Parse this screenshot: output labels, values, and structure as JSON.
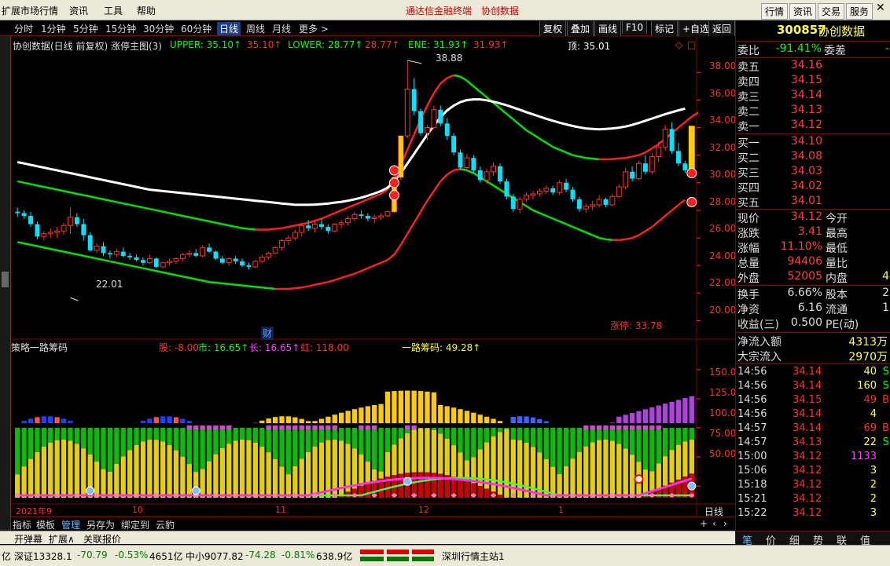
{
  "window": {
    "title": "通达信金融终端",
    "product": "协创数据"
  },
  "menu": {
    "items": [
      "扩展市场行情",
      "资讯",
      "工具",
      "帮助"
    ],
    "right_buttons": [
      "行情",
      "资讯",
      "交易",
      "服务"
    ]
  },
  "toolbar": {
    "periods": [
      "分时",
      "1分钟",
      "5分钟",
      "15分钟",
      "30分钟",
      "60分钟",
      "日线",
      "周线",
      "月线",
      "更多 >"
    ],
    "active_period": "日线",
    "right_buttons": [
      "复权",
      "叠加",
      "画线",
      "F10",
      "标记",
      "+自选",
      "返回"
    ]
  },
  "main_chart": {
    "header": "协创数据(日线 前复权) 涨停主图(3)",
    "indicators": [
      {
        "text": "UPPER: 35.10↑",
        "color": "#00ff00"
      },
      {
        "text": "35.10↑",
        "color": "#ff3030"
      },
      {
        "text": "LOWER: 28.77↑",
        "color": "#00ff00"
      },
      {
        "text": "28.77↑",
        "color": "#ff3030"
      },
      {
        "text": "ENE: 31.93↑",
        "color": "#00ff00"
      },
      {
        "text": "31.93↑",
        "color": "#ff3030"
      },
      {
        "text": "顶: 35.01",
        "color": "#ffffff"
      }
    ],
    "max_label": "38.88",
    "min_label": "22.01",
    "limit_label": "涨停: 33.78",
    "cai_label": "财",
    "yticks": [
      "38.00",
      "36.00",
      "34.00",
      "32.00",
      "30.00",
      "28.00",
      "26.00",
      "24.00",
      "22.00",
      "20.00"
    ]
  },
  "sub_chart": {
    "header": "策略一路筹码",
    "indicators": [
      {
        "text": "股: -8.00",
        "color": "#ff3030"
      },
      {
        "text": "市: 16.65↑",
        "color": "#00ff00"
      },
      {
        "text": "长: 16.65↑",
        "color": "#ff40ff"
      },
      {
        "text": "虹: 118.00",
        "color": "#ff3030"
      },
      {
        "text": "一路筹码: 49.28↑",
        "color": "#ffff00"
      }
    ],
    "yticks": [
      "150.0",
      "125.0",
      "100.0",
      "75.00",
      "50.00"
    ]
  },
  "xaxis": {
    "labels": [
      "2021年9",
      "10",
      "11",
      "12",
      "1"
    ],
    "period_label": "日线"
  },
  "tabs": [
    "指标",
    "模板",
    "管理",
    "另存为",
    "绑定到",
    "云豹"
  ],
  "active_tab": "管理",
  "bottom_buttons": [
    "开弹幕",
    "扩展∧",
    "关联报价"
  ],
  "quote": {
    "code": "300857",
    "name": "协创数据",
    "weibi_label": "委比",
    "weibi": "-91.41%",
    "weicha_label": "委差",
    "weicha": "-",
    "asks": [
      {
        "label": "卖五",
        "price": "34.16"
      },
      {
        "label": "卖四",
        "price": "34.15"
      },
      {
        "label": "卖三",
        "price": "34.14"
      },
      {
        "label": "卖二",
        "price": "34.13"
      },
      {
        "label": "卖一",
        "price": "34.12"
      }
    ],
    "bids": [
      {
        "label": "买一",
        "price": "34.10"
      },
      {
        "label": "买二",
        "price": "34.08"
      },
      {
        "label": "买三",
        "price": "34.03"
      },
      {
        "label": "买四",
        "price": "34.02"
      },
      {
        "label": "买五",
        "price": "34.01"
      }
    ],
    "stats": [
      {
        "l1": "现价",
        "v1": "34.12",
        "l2": "今开",
        "v2": ""
      },
      {
        "l1": "涨跌",
        "v1": "3.41",
        "l2": "最高",
        "v2": ""
      },
      {
        "l1": "涨幅",
        "v1": "11.10%",
        "l2": "最低",
        "v2": ""
      },
      {
        "l1": "总量",
        "v1": "94406",
        "l2": "量比",
        "v2": ""
      },
      {
        "l1": "外盘",
        "v1": "52005",
        "l2": "内盘",
        "v2": "4"
      }
    ],
    "stats2": [
      {
        "l1": "换手",
        "v1": "6.66%",
        "l2": "股本",
        "v2": "2"
      },
      {
        "l1": "净资",
        "v1": "6.16",
        "l2": "流通",
        "v2": "1"
      },
      {
        "l1": "收益(三)",
        "v1": "0.500",
        "l2": "PE(动)",
        "v2": ""
      }
    ],
    "flow": [
      {
        "label": "净流入额",
        "value": "4313万"
      },
      {
        "label": "大宗流入",
        "value": "2970万"
      }
    ],
    "ticks": [
      {
        "time": "14:56",
        "price": "34.14",
        "vol": "40",
        "flag": "S"
      },
      {
        "time": "14:56",
        "price": "34.14",
        "vol": "160",
        "flag": "S"
      },
      {
        "time": "14:56",
        "price": "34.15",
        "vol": "49",
        "flag": "B"
      },
      {
        "time": "14:56",
        "price": "34.14",
        "vol": "4",
        "flag": ""
      },
      {
        "time": "14:57",
        "price": "34.14",
        "vol": "69",
        "flag": "B"
      },
      {
        "time": "14:57",
        "price": "34.13",
        "vol": "22",
        "flag": "S"
      },
      {
        "time": "15:00",
        "price": "34.12",
        "vol": "1133",
        "flag": ""
      },
      {
        "time": "15:06",
        "price": "34.12",
        "vol": "3",
        "flag": ""
      },
      {
        "time": "15:18",
        "price": "34.12",
        "vol": "2",
        "flag": ""
      },
      {
        "time": "15:21",
        "price": "34.12",
        "vol": "2",
        "flag": ""
      },
      {
        "time": "15:22",
        "price": "34.12",
        "vol": "3",
        "flag": ""
      }
    ],
    "tabs": [
      "笔",
      "价",
      "细",
      "势",
      "联",
      "值"
    ]
  },
  "status": {
    "items": [
      {
        "text": "亿",
        "color": "#000"
      },
      {
        "text": "深证13328.1",
        "color": "#000"
      },
      {
        "text": "-70.79",
        "color": "#008000"
      },
      {
        "text": "-0.53%",
        "color": "#008000"
      },
      {
        "text": "4651亿",
        "color": "#000"
      },
      {
        "text": "中小9077.82",
        "color": "#000"
      },
      {
        "text": "-74.28",
        "color": "#008000"
      },
      {
        "text": "-0.81%",
        "color": "#008000"
      },
      {
        "text": "638.9亿",
        "color": "#000"
      },
      {
        "text": "深圳行情主站1",
        "color": "#000"
      }
    ]
  },
  "colors": {
    "up": "#ff3030",
    "down": "#00e5ff",
    "bg": "#000000",
    "grid": "#800000",
    "ene": "#ffffff",
    "upper_red": "#ff2020",
    "lower_green": "#00e000"
  },
  "chart_data": {
    "type": "candlestick",
    "price_range": [
      19,
      39.5
    ],
    "candles": [
      [
        27.9,
        28.2,
        27.5,
        27.8
      ],
      [
        27.8,
        28.0,
        27.4,
        27.6
      ],
      [
        27.6,
        27.9,
        26.8,
        27.0
      ],
      [
        27.0,
        27.2,
        25.9,
        26.1
      ],
      [
        26.1,
        26.5,
        25.8,
        26.3
      ],
      [
        26.3,
        26.7,
        26.0,
        26.4
      ],
      [
        26.4,
        26.8,
        26.0,
        26.5
      ],
      [
        26.5,
        27.1,
        26.2,
        26.9
      ],
      [
        26.9,
        28.2,
        26.3,
        27.5
      ],
      [
        27.5,
        27.8,
        26.8,
        27.0
      ],
      [
        27.0,
        27.4,
        25.8,
        26.2
      ],
      [
        26.2,
        26.4,
        25.0,
        25.1
      ],
      [
        25.1,
        25.6,
        24.9,
        25.4
      ],
      [
        25.4,
        25.7,
        24.7,
        24.9
      ],
      [
        24.9,
        25.1,
        24.5,
        24.8
      ],
      [
        24.8,
        25.2,
        24.6,
        25.0
      ],
      [
        25.0,
        25.3,
        24.6,
        24.7
      ],
      [
        24.7,
        24.9,
        24.4,
        24.6
      ],
      [
        24.6,
        24.8,
        24.3,
        24.4
      ],
      [
        24.4,
        24.6,
        24.0,
        24.2
      ],
      [
        24.2,
        24.8,
        24.1,
        24.5
      ],
      [
        24.5,
        24.6,
        23.8,
        23.9
      ],
      [
        23.9,
        24.3,
        23.8,
        24.2
      ],
      [
        24.2,
        24.5,
        24.0,
        24.3
      ],
      [
        24.3,
        24.6,
        24.1,
        24.5
      ],
      [
        24.5,
        24.9,
        24.3,
        24.8
      ],
      [
        24.8,
        25.1,
        24.6,
        24.9
      ],
      [
        24.9,
        25.2,
        24.6,
        24.7
      ],
      [
        24.7,
        25.5,
        24.6,
        25.3
      ],
      [
        25.3,
        25.6,
        24.9,
        25.0
      ],
      [
        25.0,
        25.1,
        24.4,
        24.5
      ],
      [
        24.5,
        24.7,
        24.1,
        24.2
      ],
      [
        24.2,
        24.6,
        24.0,
        24.5
      ],
      [
        24.5,
        24.7,
        24.1,
        24.3
      ],
      [
        24.3,
        24.5,
        23.9,
        24.0
      ],
      [
        24.0,
        24.2,
        23.7,
        23.9
      ],
      [
        23.9,
        24.4,
        23.8,
        24.3
      ],
      [
        24.3,
        24.8,
        24.2,
        24.6
      ],
      [
        24.6,
        25.0,
        24.4,
        24.9
      ],
      [
        24.9,
        25.4,
        24.8,
        25.3
      ],
      [
        25.3,
        25.9,
        25.1,
        25.8
      ],
      [
        25.8,
        26.2,
        25.5,
        26.0
      ],
      [
        26.0,
        26.6,
        25.8,
        26.4
      ],
      [
        26.4,
        27.1,
        26.1,
        26.9
      ],
      [
        26.9,
        27.3,
        26.5,
        26.7
      ],
      [
        26.7,
        27.2,
        26.4,
        27.0
      ],
      [
        27.0,
        27.4,
        26.6,
        26.8
      ],
      [
        26.8,
        27.0,
        26.3,
        26.5
      ],
      [
        26.5,
        27.1,
        26.4,
        27.0
      ],
      [
        27.0,
        27.3,
        26.7,
        27.1
      ],
      [
        27.1,
        27.6,
        26.9,
        27.4
      ],
      [
        27.4,
        27.9,
        27.2,
        27.7
      ],
      [
        27.7,
        28.0,
        27.4,
        27.6
      ],
      [
        27.6,
        27.8,
        27.2,
        27.4
      ],
      [
        27.4,
        27.7,
        27.1,
        27.5
      ],
      [
        27.5,
        27.8,
        27.3,
        27.6
      ],
      [
        27.6,
        28.0,
        27.5,
        27.9
      ],
      [
        27.9,
        30.4,
        27.8,
        30.4
      ],
      [
        30.4,
        33.4,
        30.2,
        33.4
      ],
      [
        33.4,
        38.88,
        33.2,
        36.8
      ],
      [
        36.8,
        37.6,
        34.9,
        35.2
      ],
      [
        35.2,
        35.4,
        33.4,
        33.6
      ],
      [
        33.6,
        34.2,
        33.1,
        34.0
      ],
      [
        34.0,
        35.6,
        33.9,
        35.3
      ],
      [
        35.3,
        35.6,
        34.1,
        34.3
      ],
      [
        34.3,
        34.7,
        33.1,
        33.4
      ],
      [
        33.4,
        33.6,
        32.0,
        32.2
      ],
      [
        32.2,
        32.4,
        30.9,
        31.1
      ],
      [
        31.1,
        32.1,
        30.8,
        31.8
      ],
      [
        31.8,
        32.0,
        30.7,
        30.9
      ],
      [
        30.9,
        31.2,
        30.0,
        30.2
      ],
      [
        30.2,
        31.0,
        29.9,
        30.8
      ],
      [
        30.8,
        31.5,
        30.5,
        31.2
      ],
      [
        31.2,
        31.4,
        29.9,
        30.1
      ],
      [
        30.1,
        30.3,
        28.8,
        29.0
      ],
      [
        29.0,
        29.2,
        27.9,
        28.1
      ],
      [
        28.1,
        29.0,
        27.8,
        28.8
      ],
      [
        28.8,
        29.3,
        28.6,
        29.1
      ],
      [
        29.1,
        29.4,
        28.8,
        29.2
      ],
      [
        29.2,
        29.6,
        29.0,
        29.4
      ],
      [
        29.4,
        29.8,
        29.2,
        29.6
      ],
      [
        29.6,
        29.8,
        29.1,
        29.3
      ],
      [
        29.3,
        30.2,
        29.1,
        30.0
      ],
      [
        30.0,
        30.3,
        29.3,
        29.5
      ],
      [
        29.5,
        29.7,
        28.6,
        28.8
      ],
      [
        28.8,
        29.0,
        27.9,
        28.1
      ],
      [
        28.1,
        28.5,
        27.8,
        28.3
      ],
      [
        28.3,
        28.7,
        28.0,
        28.4
      ],
      [
        28.4,
        29.1,
        28.2,
        28.8
      ],
      [
        28.8,
        28.9,
        28.2,
        28.4
      ],
      [
        28.4,
        29.2,
        28.3,
        29.0
      ],
      [
        29.0,
        29.9,
        28.9,
        29.7
      ],
      [
        29.7,
        31.1,
        29.5,
        30.8
      ],
      [
        30.8,
        31.2,
        30.1,
        30.3
      ],
      [
        30.3,
        31.6,
        30.2,
        31.4
      ],
      [
        31.4,
        32.0,
        30.6,
        30.8
      ],
      [
        30.8,
        32.2,
        30.6,
        31.9
      ],
      [
        31.9,
        33.0,
        31.5,
        32.6
      ],
      [
        32.6,
        34.2,
        32.3,
        33.9
      ],
      [
        33.9,
        34.4,
        32.1,
        32.3
      ],
      [
        32.3,
        32.9,
        31.2,
        31.4
      ],
      [
        31.4,
        31.6,
        30.7,
        30.9
      ],
      [
        30.9,
        34.12,
        30.9,
        34.12
      ]
    ],
    "ene": [
      31.5,
      31.4,
      31.3,
      31.2,
      31.1,
      31.0,
      30.9,
      30.8,
      30.7,
      30.6,
      30.5,
      30.4,
      30.3,
      30.2,
      30.1,
      30.0,
      29.9,
      29.8,
      29.7,
      29.6,
      29.5,
      29.45,
      29.4,
      29.35,
      29.3,
      29.25,
      29.2,
      29.15,
      29.1,
      29.05,
      29.0,
      28.95,
      28.9,
      28.85,
      28.8,
      28.75,
      28.7,
      28.65,
      28.6,
      28.55,
      28.5,
      28.45,
      28.4,
      28.4,
      28.4,
      28.42,
      28.45,
      28.5,
      28.56,
      28.62,
      28.7,
      28.8,
      28.92,
      29.06,
      29.22,
      29.4,
      29.65,
      30.1,
      30.7,
      31.4,
      32.1,
      32.8,
      33.5,
      34.15,
      34.75,
      35.25,
      35.6,
      35.85,
      36.0,
      36.05,
      36.05,
      35.98,
      35.88,
      35.76,
      35.62,
      35.46,
      35.3,
      35.12,
      34.96,
      34.8,
      34.64,
      34.5,
      34.36,
      34.24,
      34.12,
      34.02,
      33.94,
      33.9,
      33.88,
      33.9,
      33.94,
      34.0,
      34.08,
      34.2,
      34.34,
      34.5,
      34.66,
      34.82,
      34.98,
      35.12,
      35.26,
      35.38
    ],
    "upper": [
      30.1,
      30.0,
      29.9,
      29.8,
      29.7,
      29.6,
      29.5,
      29.4,
      29.3,
      29.2,
      29.1,
      29.0,
      28.9,
      28.8,
      28.7,
      28.6,
      28.5,
      28.4,
      28.3,
      28.2,
      28.1,
      28.0,
      27.9,
      27.8,
      27.7,
      27.6,
      27.5,
      27.4,
      27.3,
      27.2,
      27.1,
      27.0,
      26.9,
      26.8,
      26.7,
      26.65,
      26.6,
      26.6,
      26.6,
      26.65,
      26.7,
      26.8,
      26.9,
      27.0,
      27.1,
      27.25,
      27.4,
      27.6,
      27.8,
      28.0,
      28.2,
      28.4,
      28.6,
      28.8,
      29.0,
      29.2,
      29.5,
      30.3,
      31.3,
      32.4,
      33.5,
      34.6,
      35.6,
      36.5,
      37.2,
      37.6,
      37.8,
      37.7,
      37.4,
      37.0,
      36.6,
      36.2,
      35.8,
      35.4,
      35.0,
      34.6,
      34.2,
      33.8,
      33.5,
      33.2,
      32.9,
      32.6,
      32.4,
      32.2,
      32.0,
      31.9,
      31.8,
      31.75,
      31.7,
      31.7,
      31.72,
      31.76,
      31.8,
      31.9,
      32.0,
      32.2,
      32.5,
      32.8,
      33.2,
      33.6,
      34.0,
      34.4,
      34.8,
      35.1
    ],
    "lower": [
      25.7,
      25.6,
      25.5,
      25.4,
      25.3,
      25.2,
      25.1,
      25.0,
      24.9,
      24.8,
      24.7,
      24.6,
      24.5,
      24.4,
      24.3,
      24.2,
      24.1,
      24.0,
      23.9,
      23.8,
      23.7,
      23.6,
      23.5,
      23.4,
      23.3,
      23.2,
      23.1,
      23.0,
      22.9,
      22.8,
      22.75,
      22.7,
      22.65,
      22.6,
      22.55,
      22.5,
      22.45,
      22.4,
      22.35,
      22.3,
      22.3,
      22.3,
      22.35,
      22.4,
      22.5,
      22.6,
      22.7,
      22.8,
      22.95,
      23.1,
      23.25,
      23.4,
      23.6,
      23.8,
      24.0,
      24.2,
      24.4,
      24.8,
      25.5,
      26.3,
      27.1,
      27.9,
      28.7,
      29.4,
      30.1,
      30.6,
      30.9,
      31.0,
      30.9,
      30.7,
      30.4,
      30.1,
      29.8,
      29.5,
      29.2,
      28.9,
      28.6,
      28.3,
      28.0,
      27.8,
      27.6,
      27.4,
      27.2,
      27.0,
      26.8,
      26.6,
      26.4,
      26.2,
      26.0,
      25.9,
      25.85,
      25.85,
      25.9,
      26.0,
      26.2,
      26.5,
      26.8,
      27.2,
      27.6,
      28.0,
      28.4,
      28.77
    ],
    "sub_range": [
      40,
      160
    ]
  }
}
